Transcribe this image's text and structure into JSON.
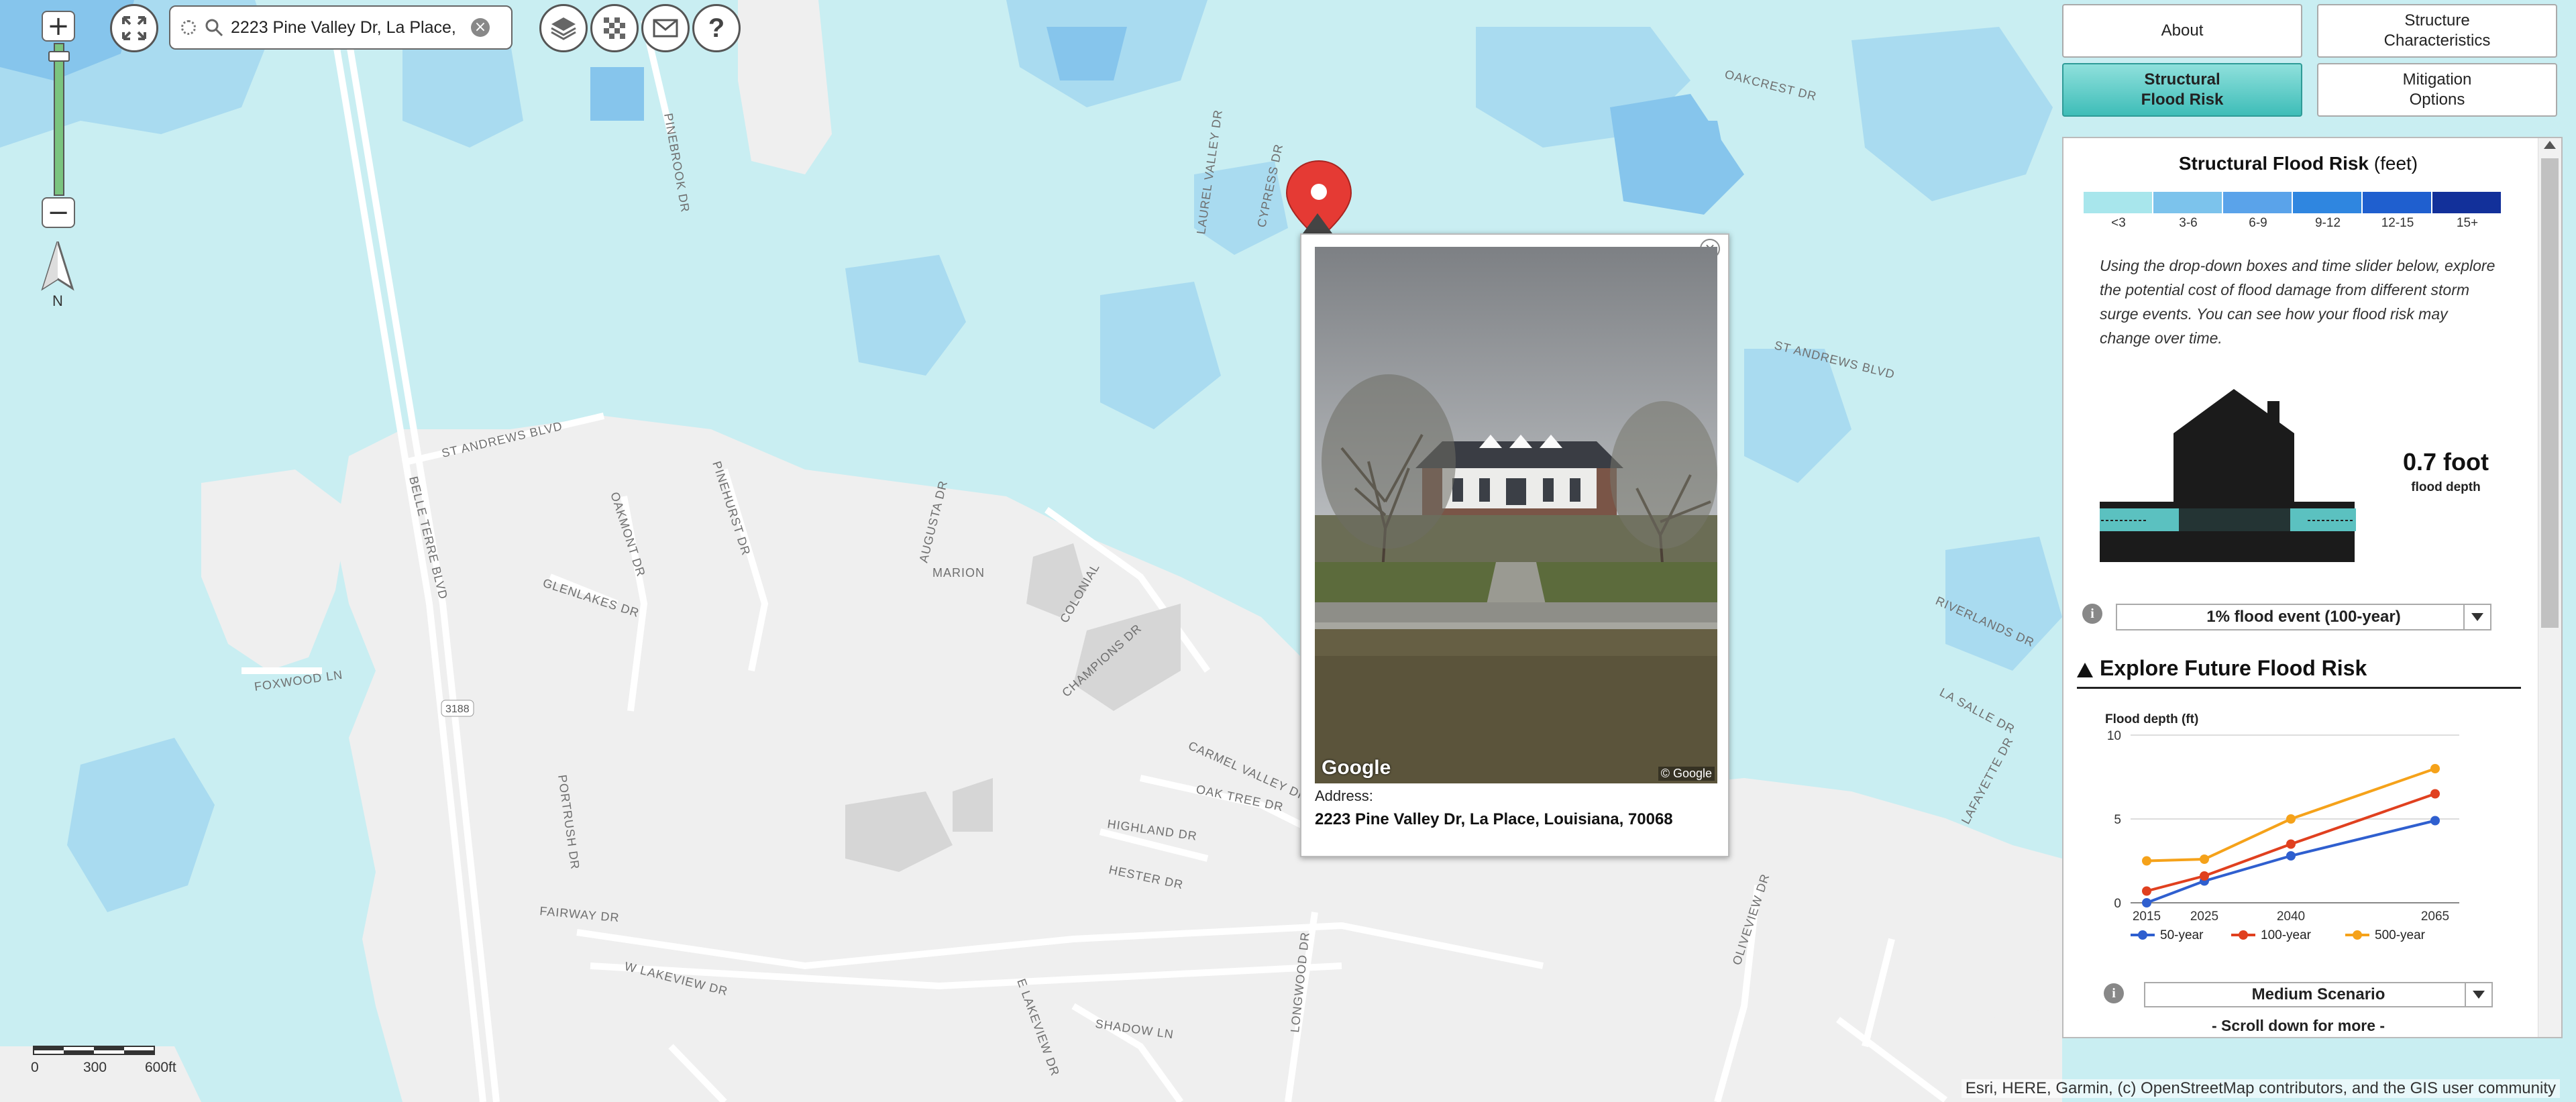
{
  "search": {
    "value": "2223 Pine Valley Dr, La Place,"
  },
  "zoom": {
    "plus": "+",
    "minus": "−",
    "north": "N"
  },
  "toolbar": {
    "icons": [
      "fullscreen-icon",
      "layers-icon",
      "basemap-icon",
      "mail-icon",
      "help-icon"
    ],
    "help_label": "?"
  },
  "map_labels": [
    {
      "text": "ST ANDREWS BLVD",
      "name": "street-st-andrews-blvd"
    },
    {
      "text": "BELLE TERRE BLVD",
      "name": "street-belle-terre-blvd"
    },
    {
      "text": "OAKMONT DR",
      "name": "street-oakmont-dr"
    },
    {
      "text": "PINEHURST DR",
      "name": "street-pinehurst-dr"
    },
    {
      "text": "GLENLAKES DR",
      "name": "street-glenlakes-dr"
    },
    {
      "text": "FOXWOOD LN",
      "name": "street-foxwood-ln"
    },
    {
      "text": "MARION",
      "name": "street-marion"
    },
    {
      "text": "COLONIAL",
      "name": "street-colonial"
    },
    {
      "text": "CHAMPIONS DR",
      "name": "street-champions-dr"
    },
    {
      "text": "AUGUSTA DR",
      "name": "street-augusta-dr"
    },
    {
      "text": "PORTRUSH DR",
      "name": "street-portrush-dr"
    },
    {
      "text": "FAIRWAY DR",
      "name": "street-fairway-dr"
    },
    {
      "text": "W LAKEVIEW DR",
      "name": "street-w-lakeview-dr"
    },
    {
      "text": "E LAKEVIEW DR",
      "name": "street-e-lakeview-dr"
    },
    {
      "text": "SHADOW LN",
      "name": "street-shadow-ln"
    },
    {
      "text": "HIGHLAND DR",
      "name": "street-highland-dr"
    },
    {
      "text": "HESTER DR",
      "name": "street-hester-dr"
    },
    {
      "text": "OAK TREE DR",
      "name": "street-oak-tree-dr"
    },
    {
      "text": "CARMEL VALLEY DR",
      "name": "street-carmel-valley-dr"
    },
    {
      "text": "LONGWOOD DR",
      "name": "street-longwood-dr"
    },
    {
      "text": "CYPRESS DR",
      "name": "street-cypress-dr"
    },
    {
      "text": "LAUREL VALLEY DR",
      "name": "street-laurel-valley-dr"
    },
    {
      "text": "ST ANDREWS BLVD",
      "name": "street-st-andrews-blvd-east"
    },
    {
      "text": "RIVERLANDS DR",
      "name": "street-riverlands-dr"
    },
    {
      "text": "LA SALLE DR",
      "name": "street-la-salle-dr"
    },
    {
      "text": "LAFAYETTE DR",
      "name": "street-lafayette-dr"
    },
    {
      "text": "OLIVEVIEW DR",
      "name": "street-oliveview-dr"
    },
    {
      "text": "PINEBROOK DR",
      "name": "street-pinebrook-dr"
    },
    {
      "text": "OAKCREST DR",
      "name": "street-oakcrest-dr"
    },
    {
      "text": "3188",
      "name": "route-shield-3188"
    }
  ],
  "scalebar": {
    "labels": [
      "0",
      "300",
      "600ft"
    ]
  },
  "popup": {
    "address_label": "Address:",
    "address_value": "2223 Pine Valley Dr, La Place, Louisiana, 70068",
    "google_logo": "Google",
    "copyright": "© Google",
    "close": "×"
  },
  "tabs": [
    {
      "label": "About"
    },
    {
      "label": "Structure\nCharacteristics"
    },
    {
      "label": "Structural\nFlood Risk",
      "active": true
    },
    {
      "label": "Mitigation\nOptions"
    }
  ],
  "panel": {
    "title_bold": "Structural Flood Risk",
    "title_unit": "(feet)",
    "legend": [
      {
        "label": "<3",
        "color": "#a8e6ec"
      },
      {
        "label": "3-6",
        "color": "#7cc3ec"
      },
      {
        "label": "6-9",
        "color": "#5aa3ea"
      },
      {
        "label": "9-12",
        "color": "#2f86e0"
      },
      {
        "label": "12-15",
        "color": "#1f5fcf"
      },
      {
        "label": "15+",
        "color": "#12309a"
      }
    ],
    "description": "Using the drop-down boxes and time slider below, explore the potential cost of flood damage from different storm surge events. You can see how your flood risk may change over time.",
    "depth_value": "0.7 foot",
    "depth_label": "flood depth",
    "event_select": "1% flood event (100-year)",
    "explore_header": "Explore Future Flood Risk",
    "scenario_select": "Medium Scenario",
    "scroll_hint": "- Scroll down for more -"
  },
  "chart_data": {
    "type": "line",
    "ylabel": "Flood depth (ft)",
    "xlabel": "",
    "x": [
      2015,
      2025,
      2040,
      2065
    ],
    "yticks": [
      0,
      5,
      10
    ],
    "ylim": [
      0,
      10
    ],
    "series": [
      {
        "name": "50-year",
        "color": "#2f5fcf",
        "values": [
          0.0,
          1.3,
          2.8,
          4.9
        ]
      },
      {
        "name": "100-year",
        "color": "#e0401f",
        "values": [
          0.7,
          1.6,
          3.5,
          6.5
        ]
      },
      {
        "name": "500-year",
        "color": "#f5a21a",
        "values": [
          2.5,
          2.6,
          5.0,
          8.0
        ]
      }
    ],
    "legend_position": "bottom",
    "grid": true
  },
  "attribution": "Esri, HERE, Garmin, (c) OpenStreetMap contributors, and the GIS user community"
}
